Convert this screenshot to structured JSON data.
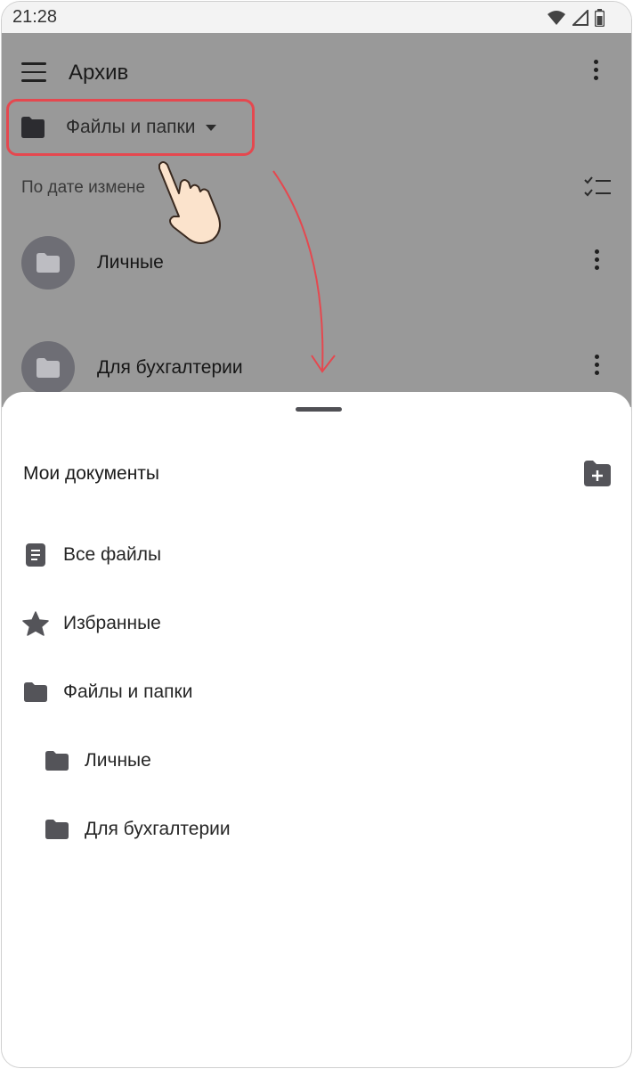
{
  "status_bar": {
    "time": "21:28"
  },
  "toolbar": {
    "title": "Архив"
  },
  "section_selector": {
    "label": "Файлы и папки"
  },
  "sort": {
    "label": "По дате измене"
  },
  "folders": [
    {
      "name": "Личные"
    },
    {
      "name": "Для бухгалтерии"
    }
  ],
  "sheet": {
    "title": "Мои документы",
    "items": [
      {
        "label": "Все файлы",
        "icon": "document-icon",
        "level": 0
      },
      {
        "label": "Избранные",
        "icon": "star-icon",
        "level": 0
      },
      {
        "label": "Файлы и папки",
        "icon": "folder-icon",
        "level": 0
      },
      {
        "label": "Личные",
        "icon": "folder-icon",
        "level": 1
      },
      {
        "label": "Для бухгалтерии",
        "icon": "folder-icon",
        "level": 1
      }
    ]
  },
  "colors": {
    "highlight": "#e5484f",
    "icon": "#545459",
    "dim": "#999999"
  }
}
